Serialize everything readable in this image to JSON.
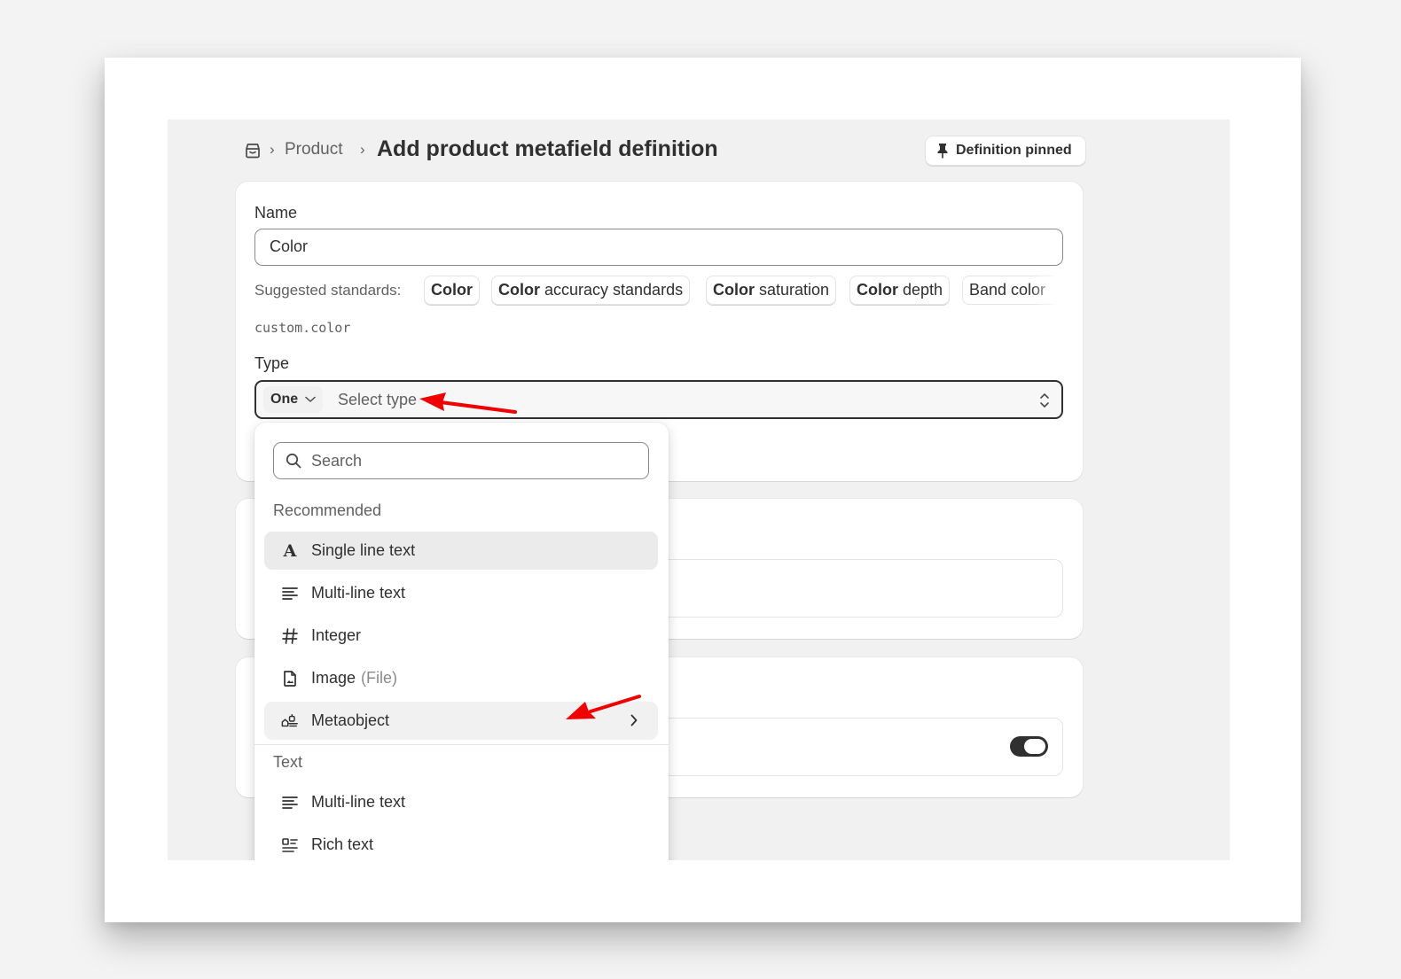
{
  "breadcrumb": {
    "home_icon": "store-icon",
    "separator": "›",
    "product_label": "Product",
    "page_title": "Add product metafield definition"
  },
  "pin_button": {
    "label": "Definition pinned",
    "icon": "pin-icon"
  },
  "name_field": {
    "label": "Name",
    "value": "Color"
  },
  "suggested": {
    "label": "Suggested standards:",
    "chips": [
      {
        "bold": "Color",
        "rest": ""
      },
      {
        "bold": "Color",
        "rest": " accuracy standards"
      },
      {
        "bold": "Color",
        "rest": " saturation"
      },
      {
        "bold": "Color",
        "rest": " depth"
      },
      {
        "bold": "",
        "rest": "Band color"
      }
    ]
  },
  "namespace_key": "custom.color",
  "type_field": {
    "label": "Type",
    "cardinality": "One",
    "placeholder": "Select type"
  },
  "dropdown": {
    "search_placeholder": "Search",
    "sections": [
      {
        "title": "Recommended",
        "options": [
          {
            "label": "Single line text",
            "icon": "text-letter-icon",
            "state": "selected"
          },
          {
            "label": "Multi-line text",
            "icon": "paragraph-icon"
          },
          {
            "label": "Integer",
            "icon": "hash-icon"
          },
          {
            "label": "Image",
            "suffix": "(File)",
            "icon": "file-image-icon"
          },
          {
            "label": "Metaobject",
            "icon": "metaobject-icon",
            "state": "hovered",
            "has_submenu": true
          }
        ]
      },
      {
        "title": "Text",
        "options": [
          {
            "label": "Multi-line text",
            "icon": "paragraph-icon"
          },
          {
            "label": "Rich text",
            "icon": "rich-text-icon"
          }
        ]
      }
    ]
  },
  "colors": {
    "annotation_arrow": "#f00000",
    "toggle_on": "#303030",
    "selected_row": "#ebebeb"
  }
}
